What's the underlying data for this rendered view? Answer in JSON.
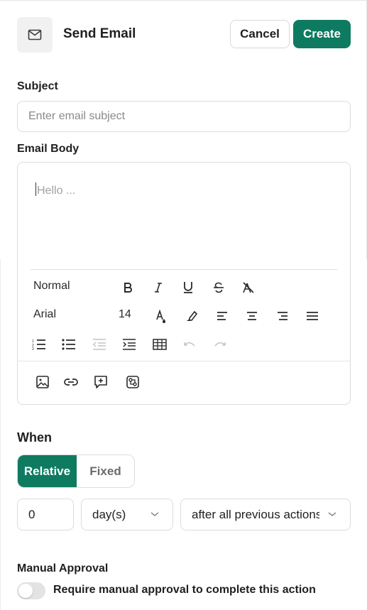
{
  "header": {
    "icon": "mail-icon",
    "title": "Send Email",
    "cancel_label": "Cancel",
    "create_label": "Create"
  },
  "subject": {
    "label": "Subject",
    "placeholder": "Enter email subject",
    "value": ""
  },
  "email_body": {
    "label": "Email Body",
    "placeholder": "Hello ..."
  },
  "toolbar": {
    "paragraph_style": "Normal",
    "font_family": "Arial",
    "font_size": "14",
    "row1_icons": [
      "bold-icon",
      "italic-icon",
      "underline-icon",
      "strikethrough-icon",
      "clear-format-icon"
    ],
    "row2_icons": [
      "text-color-icon",
      "highlight-icon",
      "align-left-icon",
      "align-center-icon",
      "align-right-icon",
      "align-justify-icon"
    ],
    "row3_icons": [
      "numbered-list-icon",
      "bulleted-list-icon",
      "outdent-icon",
      "indent-icon",
      "table-icon",
      "undo-icon",
      "redo-icon"
    ],
    "insert_icons": [
      "image-icon",
      "link-icon",
      "add-comment-icon",
      "variable-icon"
    ]
  },
  "when": {
    "label": "When",
    "options": [
      "Relative",
      "Fixed"
    ],
    "selected": "Relative",
    "amount": "0",
    "unit": "day(s)",
    "reference": "after all previous actions"
  },
  "manual_approval": {
    "label": "Manual Approval",
    "toggle_label": "Require manual approval to complete this action",
    "enabled": false
  },
  "colors": {
    "accent": "#0e7b61",
    "border": "#dcdcdc",
    "placeholder": "#8a8a8a"
  }
}
